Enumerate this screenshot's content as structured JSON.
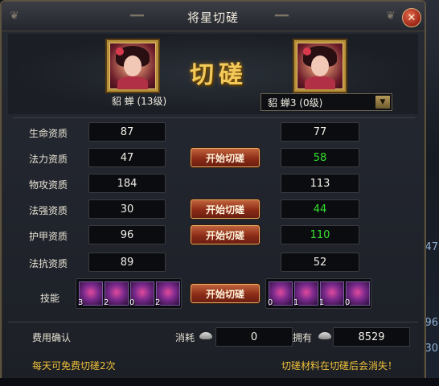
{
  "window": {
    "title": "将星切磋",
    "close_label": "✕"
  },
  "header": {
    "vs_title": "切磋",
    "left_general": "貂 蝉 (13级)",
    "opponent_selected": "貂 蝉3 (0级)"
  },
  "stats": [
    {
      "label": "生命资质",
      "left": "87",
      "right": "77",
      "right_color": "white",
      "button": ""
    },
    {
      "label": "法力资质",
      "left": "47",
      "right": "58",
      "right_color": "green",
      "button": "开始切磋"
    },
    {
      "label": "物攻资质",
      "left": "184",
      "right": "113",
      "right_color": "white",
      "button": ""
    },
    {
      "label": "法强资质",
      "left": "30",
      "right": "44",
      "right_color": "green",
      "button": "开始切磋"
    },
    {
      "label": "护甲资质",
      "left": "96",
      "right": "110",
      "right_color": "green",
      "button": "开始切磋"
    },
    {
      "label": "法抗资质",
      "left": "89",
      "right": "52",
      "right_color": "white",
      "button": ""
    }
  ],
  "skills": {
    "label": "技能",
    "button": "开始切磋",
    "left_levels": [
      "3",
      "2",
      "0",
      "2"
    ],
    "right_levels": [
      "0",
      "1",
      "1",
      "0"
    ]
  },
  "cost": {
    "label": "费用确认",
    "consume_label": "消耗",
    "consume_value": "0",
    "owned_label": "拥有",
    "owned_value": "8529"
  },
  "notices": {
    "left": "每天可免费切磋2次",
    "right": "切磋材料在切磋后会消失！"
  },
  "background": {
    "side_numbers": [
      "47",
      "96",
      "30"
    ]
  },
  "colors": {
    "accent_gold": "#f2c95a",
    "notice_yellow": "#f0c23a",
    "positive_green": "#33e02c",
    "button_red": "#8c2c18"
  }
}
